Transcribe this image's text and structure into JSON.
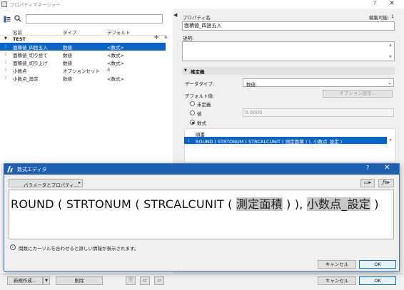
{
  "window": {
    "title": "プロパティマネージャー",
    "help": "?",
    "close": "✕"
  },
  "list": {
    "headers": {
      "name": "名前",
      "type": "タイプ",
      "default": "デフォルト"
    },
    "group": {
      "toggle": "▼",
      "label": "TEST"
    },
    "rows": [
      {
        "name": "面積値_四捨五入",
        "type": "数値",
        "default": "<数式>",
        "selected": true
      },
      {
        "name": "面積値_切り捨て",
        "type": "数値",
        "default": "<数式>",
        "selected": false
      },
      {
        "name": "面積値_切り上げ",
        "type": "数値",
        "default": "<数式>",
        "selected": false
      },
      {
        "name": "小数点",
        "type": "オプションセット",
        "default": "3",
        "selected": false
      },
      {
        "name": "小数点_設定",
        "type": "数値",
        "default": "<数式>",
        "selected": false
      }
    ]
  },
  "details": {
    "property_name_label": "プロパティ名:",
    "editable_label": "編集可能:",
    "editable_value": "1",
    "property_name_value": "面積値_四捨五入",
    "description_label": "説明:",
    "definition_section": "確定義",
    "data_type_label": "データタイプ:",
    "data_type_value": "数値",
    "default_value_label": "デフォルト値:",
    "option_settings_button": "オプション設定...",
    "radio_undefined": "未定義",
    "radio_value": "値",
    "value_field": "0.0000",
    "radio_formula": "数式",
    "expression_header": "順番",
    "expression_row": "ROUND ( STRTONUM ( STRCALCUNIT ( 測定面積 ) ), 小数点_設定 )"
  },
  "formula_editor": {
    "title": "数式エディタ",
    "help": "?",
    "close": "✕",
    "param_button": "パラメータとプロパティ...",
    "formula_parts": {
      "prefix": "ROUND ( STRTONUM ( STRCALCUNIT ( ",
      "token1": "測定面積",
      "middle": " ) ), ",
      "token2": "小数点_設定",
      "suffix": " )"
    },
    "info_text": "関数にカーソルを合わせると詳しい情報が表示されます。",
    "cancel": "キャンセル",
    "ok": "OK"
  },
  "bottom": {
    "new_button": "新規作成...",
    "delete_button": "削除",
    "cancel": "キャンセル",
    "ok": "OK"
  },
  "colors": {
    "selection": "#0a64c8",
    "dialog_title": "#1f5fb0"
  }
}
